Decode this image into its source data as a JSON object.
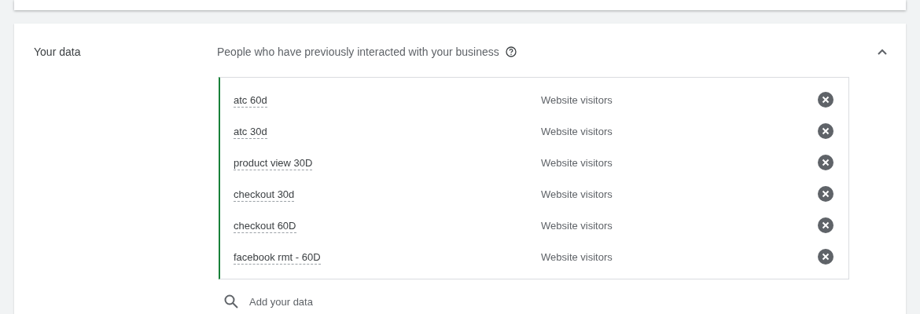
{
  "section": {
    "title": "Your data",
    "heading": "People who have previously interacted with your business",
    "expanded": true,
    "segments": [
      {
        "name": "atc 60d",
        "type": "Website visitors"
      },
      {
        "name": "atc 30d",
        "type": "Website visitors"
      },
      {
        "name": "product view 30D",
        "type": "Website visitors"
      },
      {
        "name": "checkout 30d",
        "type": "Website visitors"
      },
      {
        "name": "checkout 60D",
        "type": "Website visitors"
      },
      {
        "name": "facebook rmt - 60D",
        "type": "Website visitors"
      }
    ],
    "search": {
      "placeholder": "Add your data"
    }
  }
}
